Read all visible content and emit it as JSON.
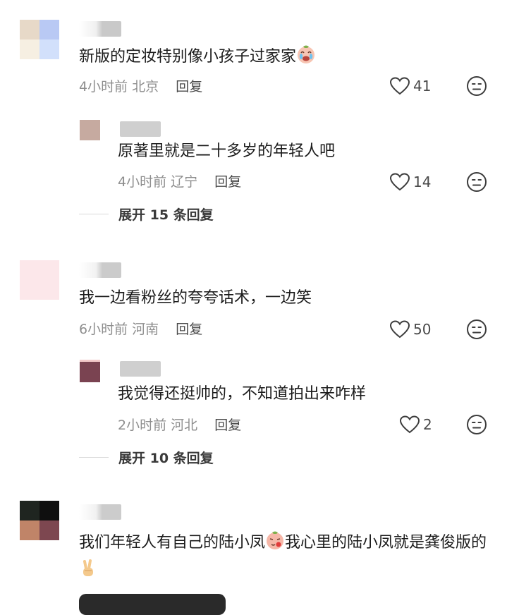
{
  "comments": [
    {
      "text": "新版的定妆特别像小孩子过家家",
      "time": "4小时前",
      "location": "北京",
      "reply_label": "回复",
      "likes": "41",
      "reply": {
        "text": "原著里就是二十多岁的年轻人吧",
        "time": "4小时前",
        "location": "辽宁",
        "reply_label": "回复",
        "likes": "14"
      },
      "expand_label": "展开 15 条回复"
    },
    {
      "text": "我一边看粉丝的夸夸话术，一边笑",
      "time": "6小时前",
      "location": "河南",
      "reply_label": "回复",
      "likes": "50",
      "reply": {
        "text": "我觉得还挺帅的，不知道拍出来咋样",
        "time": "2小时前",
        "location": "河北",
        "reply_label": "回复",
        "likes": "2"
      },
      "expand_label": "展开 10 条回复"
    },
    {
      "text_part1": "我们年轻人有自己的陆小凤",
      "text_part2": "我心里的陆小凤就是龚俊版的"
    }
  ],
  "icons": {
    "like": "heart-outline-icon",
    "dislike": "meh-face-icon",
    "emoji1": "crying-face-emoji",
    "emoji2": "smug-face-emoji",
    "emoji3": "victory-hand-emoji"
  },
  "colors": {
    "text": "#1b1b1b",
    "meta": "#8e8e8e",
    "icon": "#3c3c3c"
  }
}
